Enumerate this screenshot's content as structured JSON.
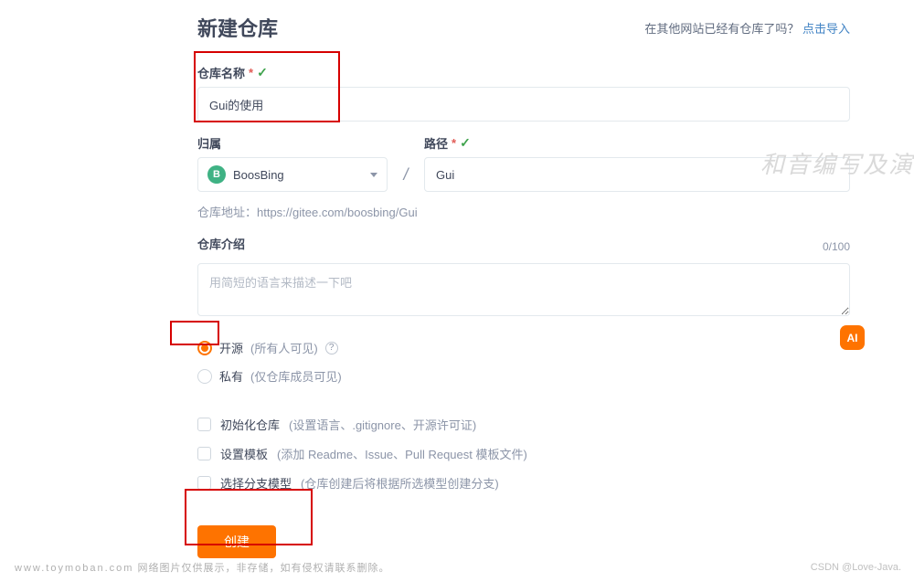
{
  "header": {
    "title": "新建仓库",
    "prompt": "在其他网站已经有仓库了吗？",
    "import_link": "点击导入"
  },
  "repo_name": {
    "label": "仓库名称",
    "value": "Gui的使用"
  },
  "owner": {
    "label": "归属",
    "avatar_letter": "B",
    "name": "BoosBing"
  },
  "path": {
    "label": "路径",
    "value": "Gui"
  },
  "url_hint": "仓库地址：https://gitee.com/boosbing/Gui",
  "description": {
    "label": "仓库介绍",
    "counter": "0/100",
    "placeholder": "用简短的语言来描述一下吧"
  },
  "visibility": {
    "public_label": "开源",
    "public_hint": "(所有人可见)",
    "private_label": "私有",
    "private_hint": "(仅仓库成员可见)"
  },
  "options": {
    "init_label": "初始化仓库",
    "init_hint": "(设置语言、.gitignore、开源许可证)",
    "template_label": "设置模板",
    "template_hint": "(添加 Readme、Issue、Pull Request 模板文件)",
    "branch_label": "选择分支模型",
    "branch_hint": "(仓库创建后将根据所选模型创建分支)"
  },
  "create_button": "创建",
  "ai_badge": "AI",
  "watermark": {
    "right": "和音编写及演",
    "footer_domain": "www.toymoban.com",
    "footer_text": "网络图片仅供展示，非存储，如有侵权请联系删除。",
    "footer_right": "CSDN @Love-Java."
  }
}
